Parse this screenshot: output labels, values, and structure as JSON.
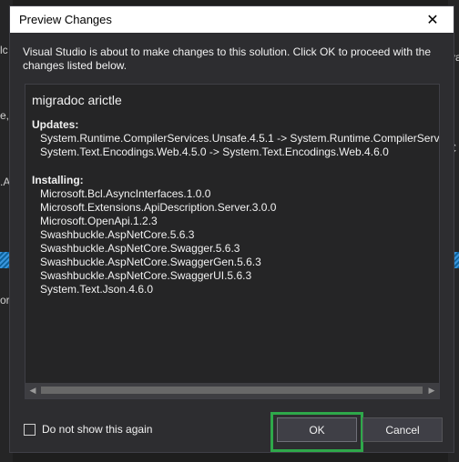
{
  "background": {
    "frag_left_1": "lc",
    "frag_left_2": "e, €",
    "frag_left_3": ".As",
    "frag_left_4": "or",
    "frag_right_1": "€",
    "frag_right_2": "va"
  },
  "dialog": {
    "title": "Preview Changes",
    "close_glyph": "✕",
    "message": "Visual Studio is about to make changes to this solution. Click OK to proceed with the changes listed below.",
    "project_name": "migradoc arictle",
    "updates_header": "Updates:",
    "updates": [
      "System.Runtime.CompilerServices.Unsafe.4.5.1 -> System.Runtime.CompilerServ",
      "System.Text.Encodings.Web.4.5.0 -> System.Text.Encodings.Web.4.6.0"
    ],
    "installing_header": "Installing:",
    "installing": [
      "Microsoft.Bcl.AsyncInterfaces.1.0.0",
      "Microsoft.Extensions.ApiDescription.Server.3.0.0",
      "Microsoft.OpenApi.1.2.3",
      "Swashbuckle.AspNetCore.5.6.3",
      "Swashbuckle.AspNetCore.Swagger.5.6.3",
      "Swashbuckle.AspNetCore.SwaggerGen.5.6.3",
      "Swashbuckle.AspNetCore.SwaggerUI.5.6.3",
      "System.Text.Json.4.6.0"
    ],
    "checkbox_label": "Do not show this again",
    "checkbox_checked": false,
    "ok_label": "OK",
    "cancel_label": "Cancel",
    "highlight_color": "#2ea84a"
  }
}
